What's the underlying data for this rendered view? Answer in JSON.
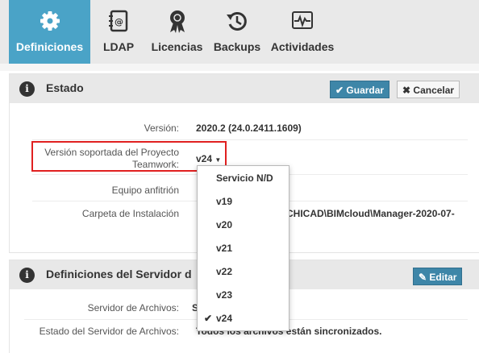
{
  "tabs": [
    {
      "label": "Definiciones",
      "icon": "gear-icon",
      "active": true
    },
    {
      "label": "LDAP",
      "icon": "address-book-icon",
      "active": false
    },
    {
      "label": "Licencias",
      "icon": "award-icon",
      "active": false
    },
    {
      "label": "Backups",
      "icon": "history-icon",
      "active": false
    },
    {
      "label": "Actividades",
      "icon": "activity-icon",
      "active": false
    }
  ],
  "estado": {
    "title": "Estado",
    "save_label": "Guardar",
    "cancel_label": "Cancelar",
    "version_label": "Versión:",
    "version_value": "2020.2 (24.0.2411.1609)",
    "supported_label_1": "Versión soportada del Proyecto",
    "supported_label_2": "Teamwork:",
    "supported_value": "v24",
    "host_label": "Equipo anfitrión",
    "install_label": "Carpeta de Instalación",
    "install_value": "CHICAD\\BIMcloud\\Manager-2020-07-"
  },
  "dropdown": {
    "options": [
      "Servicio N/D",
      "v19",
      "v20",
      "v21",
      "v22",
      "v23",
      "v24"
    ],
    "selected": "v24"
  },
  "server": {
    "title": "Definiciones del Servidor d",
    "edit_label": "Editar",
    "files_server_label": "Servidor de Archivos:",
    "files_server_value": "S",
    "files_state_label": "Estado del Servidor de Archivos:",
    "files_state_value": "Todos los archivos están sincronizados."
  },
  "colors": {
    "accent": "#4aa3c7",
    "primary_button": "#3e86a8",
    "highlight_border": "#e02020"
  }
}
